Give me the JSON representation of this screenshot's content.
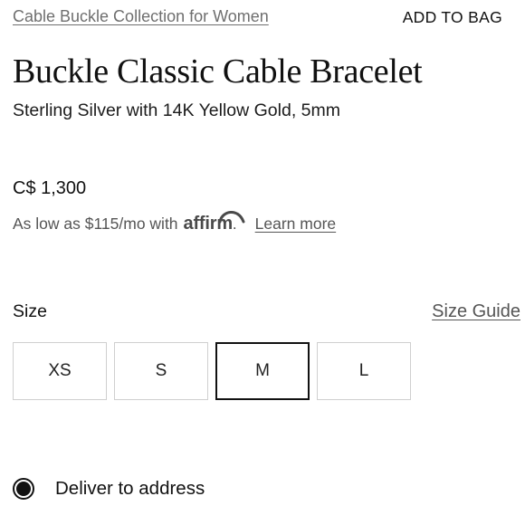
{
  "breadcrumb": {
    "collection_link": "Cable Buckle Collection for Women"
  },
  "header": {
    "add_to_bag": "ADD TO BAG"
  },
  "product": {
    "title": "Buckle Classic Cable Bracelet",
    "subtitle": "Sterling Silver with 14K Yellow Gold, 5mm",
    "price": "C$ 1,300"
  },
  "financing": {
    "prefix": "As low as $115/mo with",
    "logo_text": "affirm",
    "logo_suffix": ".",
    "learn_more": "Learn more"
  },
  "size": {
    "label": "Size",
    "guide_link": "Size Guide",
    "options": [
      "XS",
      "S",
      "M",
      "L"
    ],
    "selected": "M"
  },
  "delivery": {
    "option_label": "Deliver to address",
    "selected": true
  },
  "colors": {
    "text": "#111111",
    "muted": "#555555",
    "border": "#cfcfcf",
    "selected_border": "#111111"
  }
}
